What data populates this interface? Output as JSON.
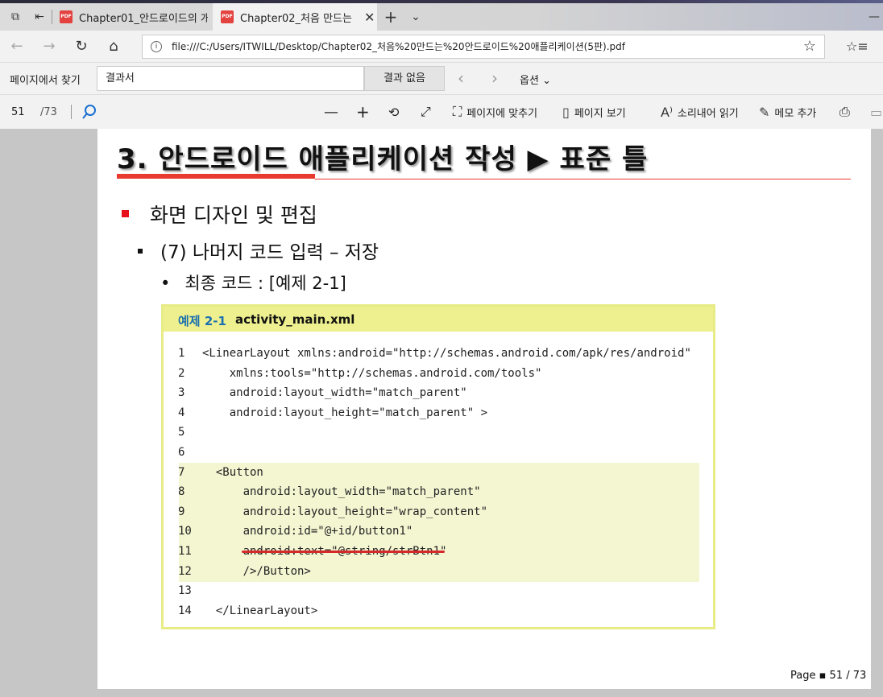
{
  "browser": {
    "tabs": [
      {
        "label": "Chapter01_안드로이드의 개",
        "active": false,
        "icon": "pdf-icon"
      },
      {
        "label": "Chapter02_처음 만드는",
        "active": true,
        "icon": "pdf-icon"
      }
    ],
    "address": "file:///C:/Users/ITWILL/Desktop/Chapter02_처음%20만드는%20안드로이드%20애플리케이션(5판).pdf"
  },
  "find_bar": {
    "label": "페이지에서 찾기",
    "query": "결과서",
    "result": "결과 없음",
    "options_label": "옵션"
  },
  "pdf_toolbar": {
    "page_number": "51",
    "page_total": "/73",
    "fit_page": "페이지에 맞추기",
    "page_view": "페이지 보기",
    "read_aloud": "소리내어 읽기",
    "add_note": "메모 추가"
  },
  "slide": {
    "title": "3. 안드로이드 애플리케이션 작성 ▶ 표준 틀",
    "bullet1": "화면 디자인 및 편집",
    "bullet2": "(7) 나머지 코드 입력 – 저장",
    "bullet3": "최종 코드 : [예제 2-1]",
    "example": {
      "number": "예제 2-1",
      "filename": "activity_main.xml",
      "lines": [
        {
          "n": "1",
          "text": "<LinearLayout xmlns:android=\"http://schemas.android.com/apk/res/android\""
        },
        {
          "n": "2",
          "text": "    xmlns:tools=\"http://schemas.android.com/tools\""
        },
        {
          "n": "3",
          "text": "    android:layout_width=\"match_parent\""
        },
        {
          "n": "4",
          "text": "    android:layout_height=\"match_parent\" >"
        },
        {
          "n": "5",
          "text": ""
        },
        {
          "n": "6",
          "text": ""
        },
        {
          "n": "7",
          "text": "  <Button"
        },
        {
          "n": "8",
          "text": "      android:layout_width=\"match_parent\""
        },
        {
          "n": "9",
          "text": "      android:layout_height=\"wrap_content\""
        },
        {
          "n": "10",
          "text": "      android:id=\"@+id/button1\""
        },
        {
          "n": "11",
          "text": "      android:text=\"@string/strBtn1\""
        },
        {
          "n": "12",
          "text": "      />/Button>"
        },
        {
          "n": "13",
          "text": ""
        },
        {
          "n": "14",
          "text": "  </LinearLayout>"
        }
      ]
    },
    "footer": "Page ▪ 51 / 73"
  }
}
